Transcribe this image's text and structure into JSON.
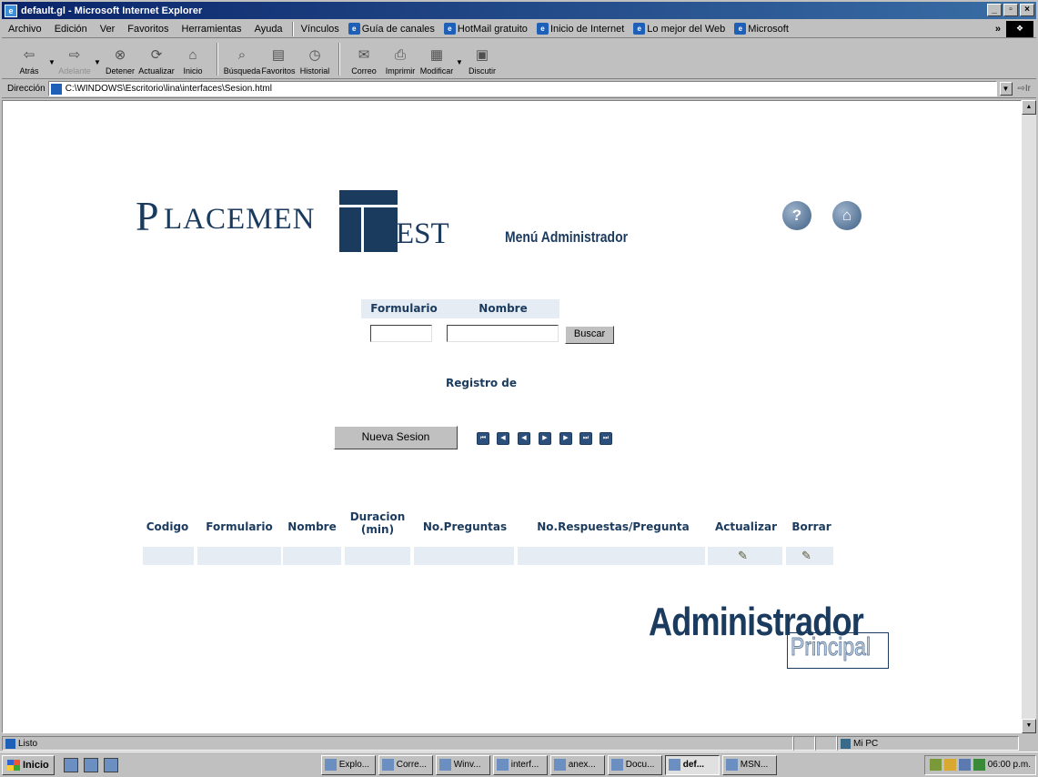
{
  "window": {
    "title": "default.gl - Microsoft Internet Explorer",
    "app_icon": "ie-icon",
    "controls": {
      "minimize": "_",
      "maximize": "▫",
      "close": "×"
    }
  },
  "menubar": {
    "items": [
      "Archivo",
      "Edición",
      "Ver",
      "Favoritos",
      "Herramientas",
      "Ayuda"
    ],
    "links_label": "Vínculos",
    "links": [
      "Guía de canales",
      "HotMail gratuito",
      "Inicio de Internet",
      "Lo mejor del Web",
      "Microsoft"
    ],
    "chevron": "»"
  },
  "toolbar": {
    "back": "Atrás",
    "forward": "Adelante",
    "stop": "Detener",
    "refresh": "Actualizar",
    "home": "Inicio",
    "search": "Búsqueda",
    "favorites": "Favoritos",
    "history": "Historial",
    "mail": "Correo",
    "print": "Imprimir",
    "edit": "Modificar",
    "discuss": "Discutir"
  },
  "address": {
    "label": "Dirección",
    "value": "C:\\WINDOWS\\Escritorio\\lina\\interfaces\\Sesion.html",
    "go": "Ir"
  },
  "page": {
    "logo": {
      "p": "P",
      "lacemen": "LACEMEN",
      "t": "T",
      "est": "EST"
    },
    "menu_title": "Menú Administrador",
    "help_icon": "?",
    "home_icon": "⌂",
    "search": {
      "col_formulario": "Formulario",
      "col_nombre": "Nombre",
      "formulario_value": "",
      "nombre_value": "",
      "buscar_label": "Buscar"
    },
    "registro_label": "Registro de",
    "nueva_sesion_label": "Nueva Sesion",
    "nav_icons": [
      "⏮",
      "◀",
      "◀",
      "▶",
      "▶",
      "⏭",
      "⏭"
    ],
    "table": {
      "headers": [
        "Codigo",
        "Formulario",
        "Nombre",
        "Duracion\n(min)",
        "No.Preguntas",
        "No.Respuestas/Pregunta",
        "Actualizar",
        "Borrar"
      ],
      "edit_glyph": "✎"
    },
    "admin_logo": {
      "word": "Administrador",
      "sub": "Principal"
    }
  },
  "statusbar": {
    "text": "Listo",
    "zone": "Mi PC"
  },
  "taskbar": {
    "start": "Inicio",
    "tasks": [
      "Explo...",
      "Corre...",
      "Winv...",
      "interf...",
      "anex...",
      "Docu...",
      "def...",
      "MSN..."
    ],
    "active_index": 6,
    "clock": "06:00 p.m."
  }
}
